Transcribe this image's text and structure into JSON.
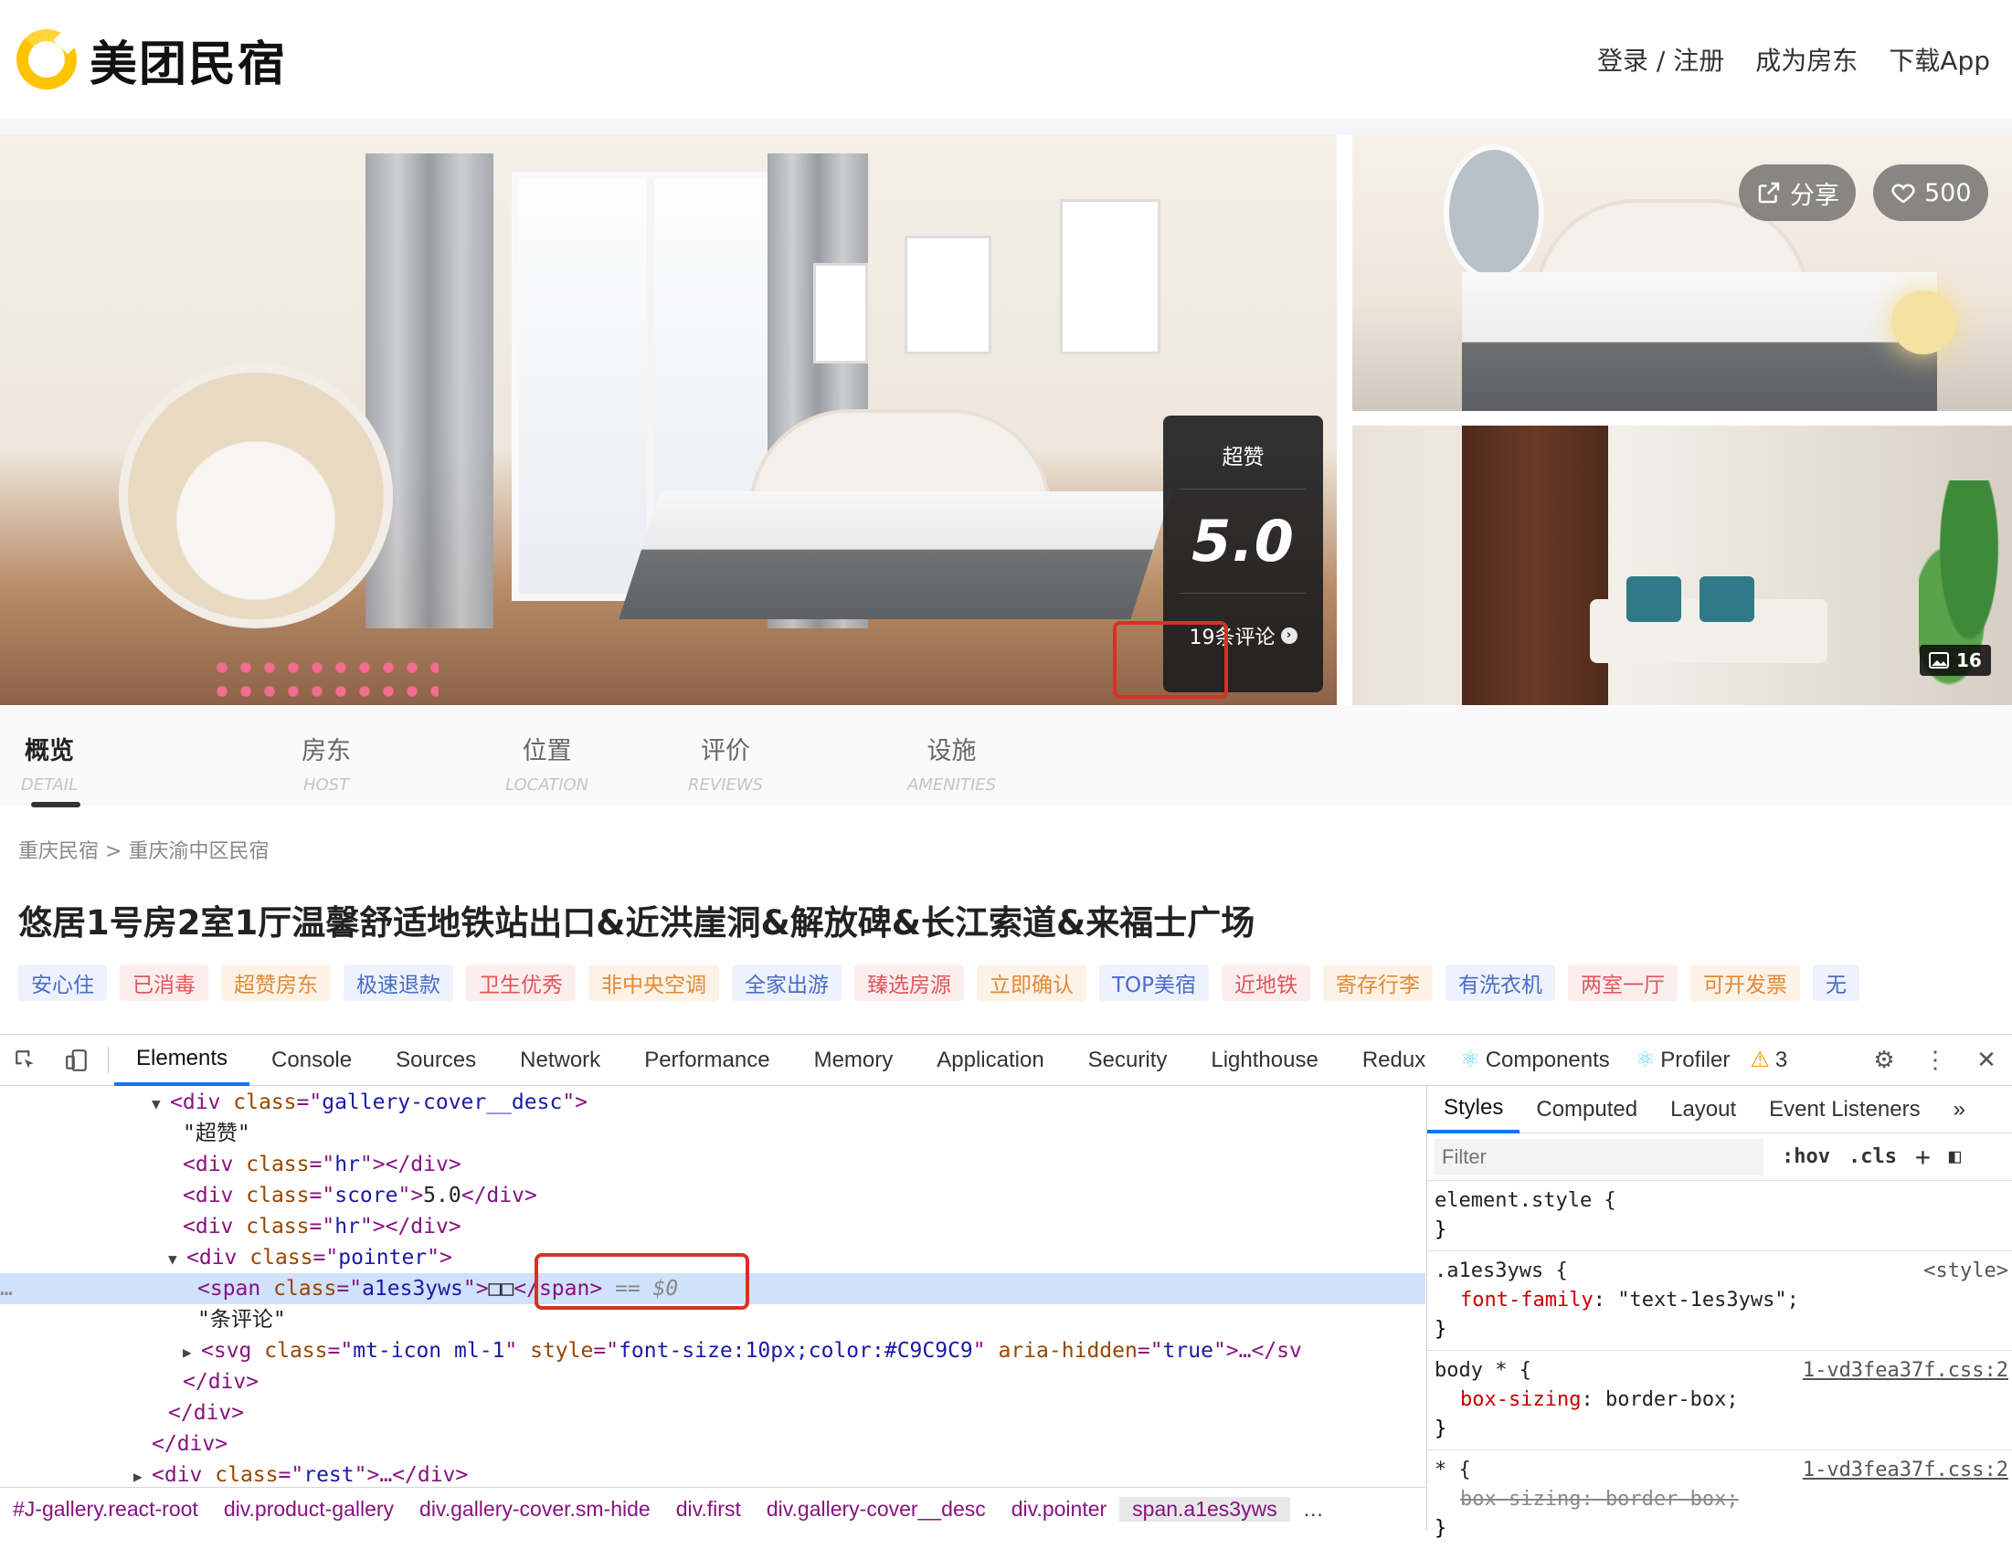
{
  "header": {
    "logo_text": "美团民宿",
    "nav": [
      "登录 / 注册",
      "成为房东",
      "下载App"
    ]
  },
  "gallery": {
    "score_label": "超赞",
    "score_value": "5.0",
    "reviews_text": "19条评论",
    "share_label": "分享",
    "favorite_count": "500",
    "photo_count": "16"
  },
  "tabs": [
    {
      "cn": "概览",
      "en": "DETAIL"
    },
    {
      "cn": "房东",
      "en": "HOST"
    },
    {
      "cn": "位置",
      "en": "LOCATION"
    },
    {
      "cn": "评价",
      "en": "REVIEWS"
    },
    {
      "cn": "设施",
      "en": "AMENITIES"
    }
  ],
  "breadcrumb": {
    "item1": "重庆民宿",
    "sep": " > ",
    "item2": "重庆渝中区民宿"
  },
  "title": "悠居1号房2室1厅温馨舒适地铁站出口&近洪崖洞&解放碑&长江索道&来福士广场",
  "tags": [
    {
      "text": "安心住",
      "color": "blue"
    },
    {
      "text": "已消毒",
      "color": "red"
    },
    {
      "text": "超赞房东",
      "color": "orange"
    },
    {
      "text": "极速退款",
      "color": "blue"
    },
    {
      "text": "卫生优秀",
      "color": "red"
    },
    {
      "text": "非中央空调",
      "color": "orange"
    },
    {
      "text": "全家出游",
      "color": "blue"
    },
    {
      "text": "臻选房源",
      "color": "red"
    },
    {
      "text": "立即确认",
      "color": "orange"
    },
    {
      "text": "TOP美宿",
      "color": "blue"
    },
    {
      "text": "近地铁",
      "color": "red"
    },
    {
      "text": "寄存行李",
      "color": "orange"
    },
    {
      "text": "有洗衣机",
      "color": "blue"
    },
    {
      "text": "两室一厅",
      "color": "red"
    },
    {
      "text": "可开发票",
      "color": "orange"
    },
    {
      "text": "无",
      "color": "blue"
    }
  ],
  "devtools": {
    "tabs": [
      "Elements",
      "Console",
      "Sources",
      "Network",
      "Performance",
      "Memory",
      "Application",
      "Security",
      "Lighthouse",
      "Redux",
      "Components",
      "Profiler"
    ],
    "warning_count": "3",
    "elements_tree": {
      "l1_tag": "div",
      "l1_attr": "class",
      "l1_val": "gallery-cover__desc",
      "l2_text": "\"超赞\"",
      "l3_tag": "div",
      "l3_attr": "class",
      "l3_val": "hr",
      "l4_tag": "div",
      "l4_attr": "class",
      "l4_val": "score",
      "l4_text": "5.0",
      "l5_tag": "div",
      "l5_attr": "class",
      "l5_val": "hr",
      "l6_tag": "div",
      "l6_attr": "class",
      "l6_val": "pointer",
      "l7_tag": "span",
      "l7_attr": "class",
      "l7_val": "a1es3yws",
      "l7_text": "□□",
      "l7_eq": " == ",
      "l7_dollar": "$0",
      "l8_text": "\"条评论\"",
      "l9_tag": "svg",
      "l9_attr1": "class",
      "l9_val1": "mt-icon ml-1",
      "l9_attr2": "style",
      "l9_val2": "font-size:10px;color:#C9C9C9",
      "l9_attr3": "aria-hidden",
      "l9_val3": "true",
      "l9_rest": ">…</sv",
      "l10_close": "</div>",
      "l11_close": "</div>",
      "l12_close": "</div>",
      "l13_tag": "div",
      "l13_attr": "class",
      "l13_val": "rest",
      "l13_rest": ">…</div>"
    },
    "breadcrumbs": [
      "#J-gallery.react-root",
      "div.product-gallery",
      "div.gallery-cover.sm-hide",
      "div.first",
      "div.gallery-cover__desc",
      "div.pointer",
      "span.a1es3yws"
    ],
    "styles": {
      "tabs": [
        "Styles",
        "Computed",
        "Layout",
        "Event Listeners"
      ],
      "filter_placeholder": "Filter",
      "hov": ":hov",
      "cls": ".cls",
      "rule1_selector": "element.style {",
      "rule2_selector": ".a1es3yws {",
      "rule2_source": "<style>",
      "rule2_prop": "font-family",
      "rule2_value": "\"text-1es3yws\";",
      "rule3_selector": "body * {",
      "rule3_source": "1-vd3fea37f.css:2",
      "rule3_prop": "box-sizing",
      "rule3_value": "border-box;",
      "rule4_selector": "* {",
      "rule4_source": "1-vd3fea37f.css:2",
      "rule4_prop_full": "box-sizing: border-box;"
    }
  }
}
